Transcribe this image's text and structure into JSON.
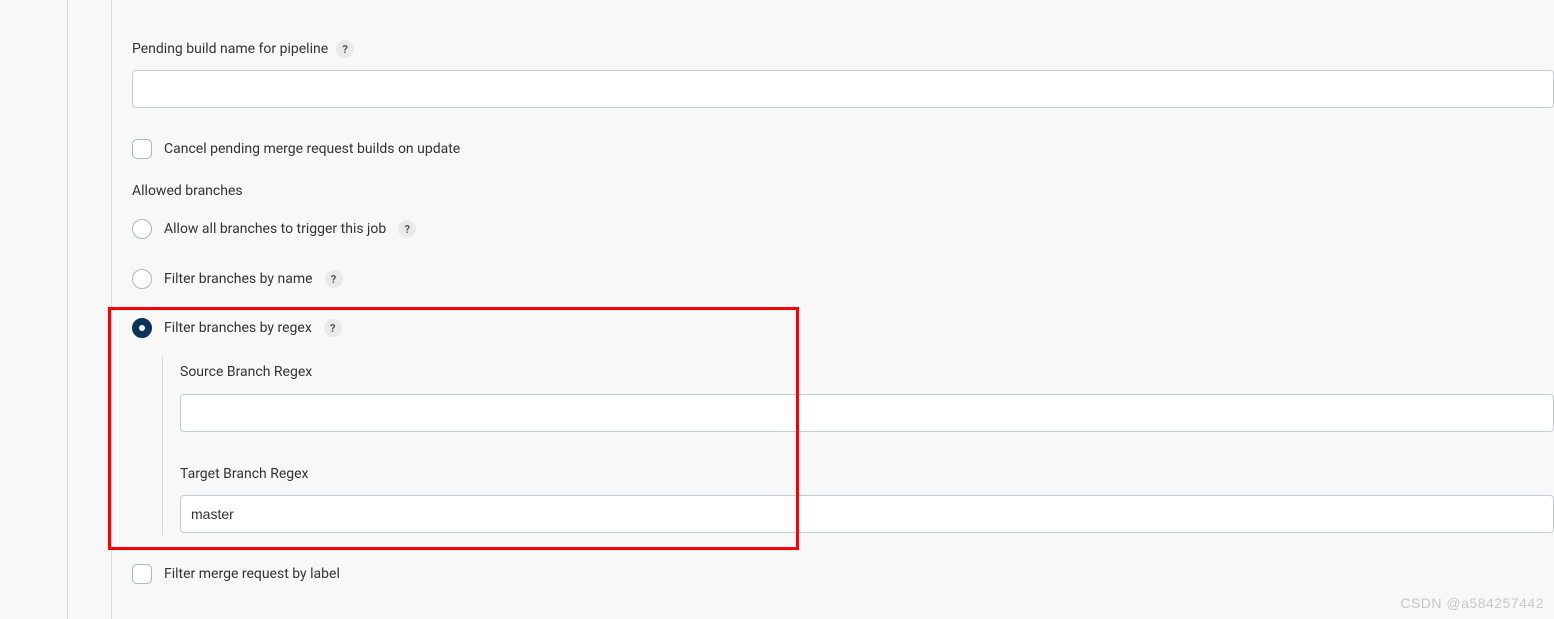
{
  "pending_build": {
    "label": "Pending build name for pipeline",
    "value": ""
  },
  "cancel_pending": {
    "label": "Cancel pending merge request builds on update"
  },
  "allowed_branches": {
    "heading": "Allowed branches",
    "options": {
      "allow_all": {
        "label": "Allow all branches to trigger this job"
      },
      "by_name": {
        "label": "Filter branches by name"
      },
      "by_regex": {
        "label": "Filter branches by regex",
        "source": {
          "label": "Source Branch Regex",
          "value": ""
        },
        "target": {
          "label": "Target Branch Regex",
          "value": "master"
        }
      }
    }
  },
  "filter_label": {
    "label": "Filter merge request by label"
  },
  "watermark": "CSDN @a584257442"
}
